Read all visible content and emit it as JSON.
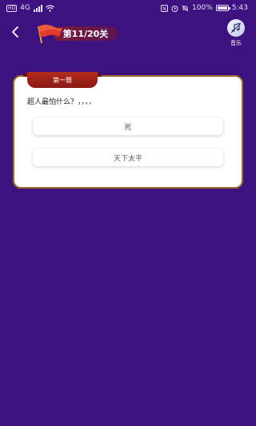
{
  "status_bar": {
    "signal_text": "4G",
    "hd_label": "HD",
    "battery_percent": "100%",
    "battery_level": 1.0,
    "time": "5:43"
  },
  "header": {
    "level_label": "第11/20关",
    "music_label": "音乐"
  },
  "question_card": {
    "tab_label": "第一题",
    "question_text": "超人最怕什么？，，，，",
    "options": [
      {
        "label": "死"
      },
      {
        "label": "天下太平"
      }
    ]
  },
  "colors": {
    "background": "#3d1280",
    "card_border": "#9a6a2a",
    "tab_red": "#b32a1e",
    "level_pill": "#7a1b3a"
  },
  "icons": {
    "back": "chevron-left-icon",
    "flag": "red-flag-icon",
    "music": "music-note-icon"
  }
}
